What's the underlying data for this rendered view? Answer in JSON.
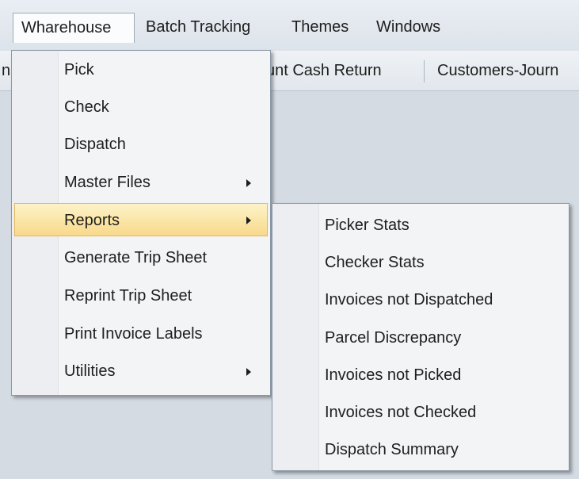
{
  "menubar": {
    "items": [
      "Wharehouse",
      "Batch Tracking",
      "Themes",
      "Windows"
    ]
  },
  "toolbar": {
    "left_fragment": "n",
    "item1": "unt Cash Return",
    "item2": "Customers-Journ"
  },
  "wharehouse_menu": {
    "items": [
      {
        "label": "Pick"
      },
      {
        "label": "Check"
      },
      {
        "label": "Dispatch"
      },
      {
        "label": "Master Files",
        "submenu": true
      },
      {
        "label": "Reports",
        "submenu": true,
        "highlighted": true
      },
      {
        "label": "Generate Trip Sheet"
      },
      {
        "label": "Reprint Trip Sheet"
      },
      {
        "label": "Print Invoice Labels"
      },
      {
        "label": "Utilities",
        "submenu": true
      }
    ]
  },
  "reports_submenu": {
    "items": [
      {
        "label": "Picker Stats"
      },
      {
        "label": "Checker Stats"
      },
      {
        "label": "Invoices not Dispatched"
      },
      {
        "label": "Parcel Discrepancy"
      },
      {
        "label": "Invoices not Picked"
      },
      {
        "label": "Invoices not Checked"
      },
      {
        "label": "Dispatch Summary"
      }
    ]
  },
  "colors": {
    "highlight_top": "#fdf3c9",
    "highlight_bottom": "#f8d98a",
    "menu_bg": "#f3f4f6",
    "background": "#d4dbe3"
  }
}
